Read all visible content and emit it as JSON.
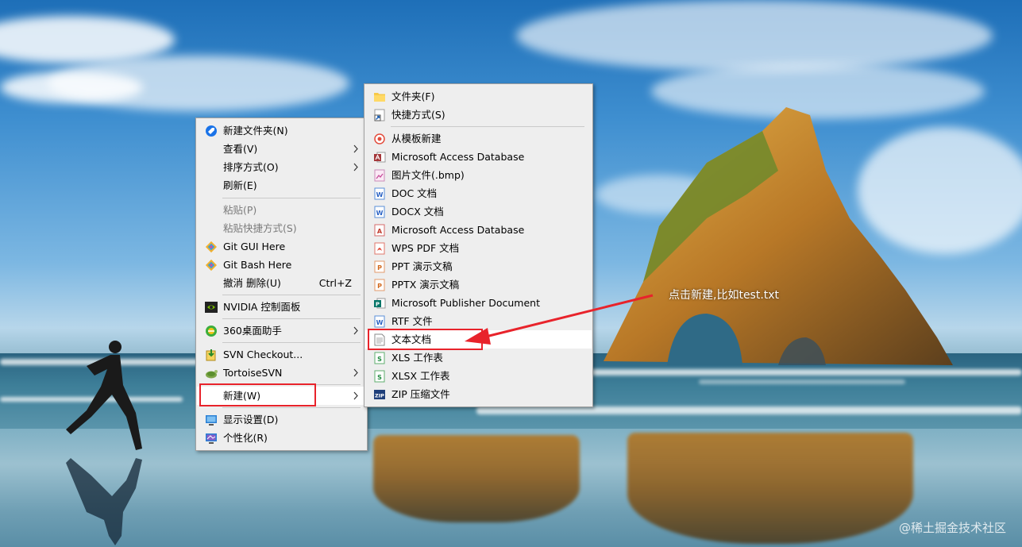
{
  "context_menu": {
    "items": [
      {
        "label": "新建文件夹(N)",
        "icon": "new-folder-icon"
      },
      {
        "label": "查看(V)",
        "submenu": true
      },
      {
        "label": "排序方式(O)",
        "submenu": true
      },
      {
        "label": "刷新(E)"
      },
      {
        "label": "粘贴(P)",
        "disabled": true
      },
      {
        "label": "粘贴快捷方式(S)",
        "disabled": true
      },
      {
        "label": "Git GUI Here",
        "icon": "git-icon"
      },
      {
        "label": "Git Bash Here",
        "icon": "git-icon"
      },
      {
        "label": "撤消 删除(U)",
        "shortcut": "Ctrl+Z"
      },
      {
        "label": "NVIDIA 控制面板",
        "icon": "nvidia-icon"
      },
      {
        "label": "360桌面助手",
        "icon": "360-icon",
        "submenu": true
      },
      {
        "label": "SVN Checkout...",
        "icon": "svn-checkout-icon"
      },
      {
        "label": "TortoiseSVN",
        "icon": "tortoisesvn-icon",
        "submenu": true
      },
      {
        "label": "新建(W)",
        "submenu": true,
        "highlighted": true
      },
      {
        "label": "显示设置(D)",
        "icon": "display-settings-icon"
      },
      {
        "label": "个性化(R)",
        "icon": "personalize-icon"
      }
    ]
  },
  "new_submenu": {
    "items": [
      {
        "label": "文件夹(F)",
        "icon": "folder-icon"
      },
      {
        "label": "快捷方式(S)",
        "icon": "shortcut-icon"
      },
      {
        "label": "从模板新建",
        "icon": "template-icon"
      },
      {
        "label": "Microsoft Access Database",
        "icon": "access-icon"
      },
      {
        "label": "图片文件(.bmp)",
        "icon": "bmp-icon"
      },
      {
        "label": "DOC 文档",
        "icon": "doc-icon"
      },
      {
        "label": "DOCX 文档",
        "icon": "docx-icon"
      },
      {
        "label": "Microsoft Access Database",
        "icon": "access-icon"
      },
      {
        "label": "WPS PDF 文档",
        "icon": "pdf-icon"
      },
      {
        "label": "PPT 演示文稿",
        "icon": "ppt-icon"
      },
      {
        "label": "PPTX 演示文稿",
        "icon": "pptx-icon"
      },
      {
        "label": "Microsoft Publisher Document",
        "icon": "publisher-icon"
      },
      {
        "label": "RTF 文件",
        "icon": "rtf-icon"
      },
      {
        "label": "文本文档",
        "icon": "text-document-icon",
        "highlighted": true
      },
      {
        "label": "XLS 工作表",
        "icon": "xls-icon"
      },
      {
        "label": "XLSX 工作表",
        "icon": "xlsx-icon"
      },
      {
        "label": "ZIP 压缩文件",
        "icon": "zip-icon"
      }
    ]
  },
  "annotation": {
    "text": "点击新建,比如test.txt",
    "color": "#e8232b"
  },
  "watermark": "@稀土掘金技术社区"
}
